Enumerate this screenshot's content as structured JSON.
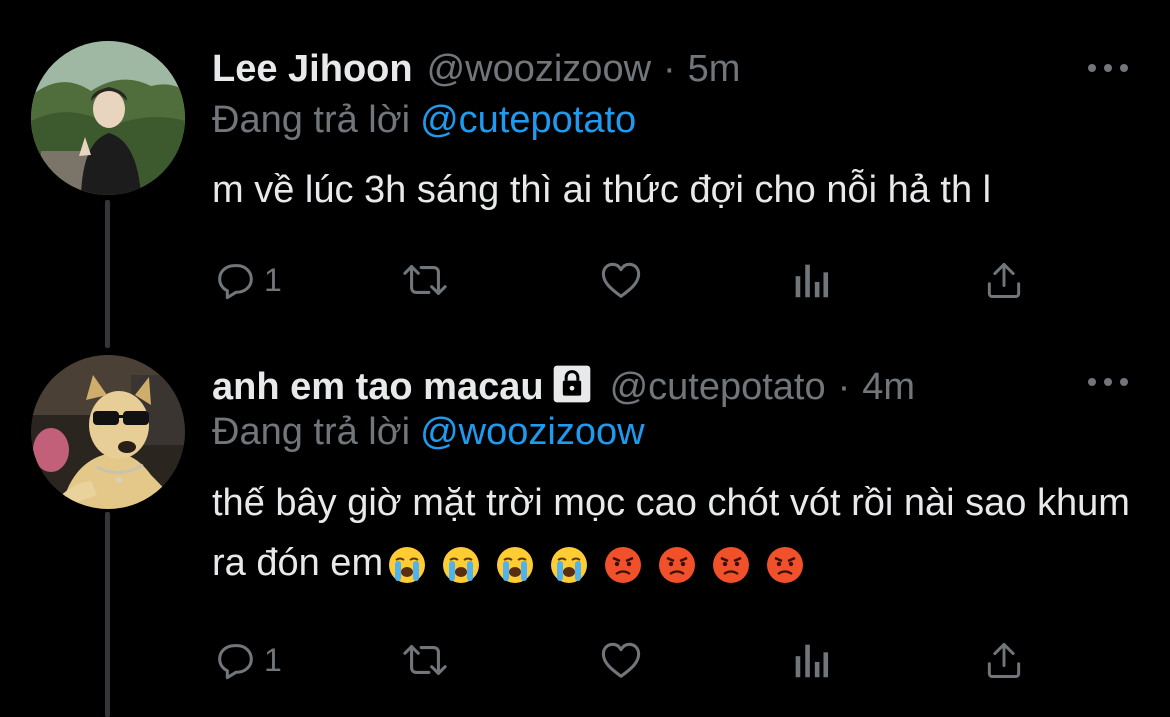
{
  "tweets": [
    {
      "name": "Lee Jihoon",
      "handle": "@woozizoow",
      "separator": "·",
      "time": "5m",
      "replying_label": "Đang trả lời",
      "replying_to": "@cutepotato",
      "text": "m về lúc 3h sáng thì ai thức đợi cho nỗi hả th l",
      "reply_count": "1",
      "protected": false
    },
    {
      "name": "anh em tao macau",
      "handle": "@cutepotato",
      "separator": "·",
      "time": "4m",
      "replying_label": "Đang trả lời",
      "replying_to": "@woozizoow",
      "text": "thế bây giờ mặt trời mọc cao chót vót rồi nài sao khum ra đón em",
      "emojis": [
        "loudly-crying-face",
        "loudly-crying-face",
        "loudly-crying-face",
        "loudly-crying-face",
        "angry-face",
        "angry-face",
        "angry-face",
        "angry-face"
      ],
      "reply_count": "1",
      "protected": true
    }
  ],
  "colors": {
    "background": "#000000",
    "text_primary": "#e7e9ea",
    "text_secondary": "#71767b",
    "link": "#1d9bf0",
    "thread_line": "#333639"
  }
}
